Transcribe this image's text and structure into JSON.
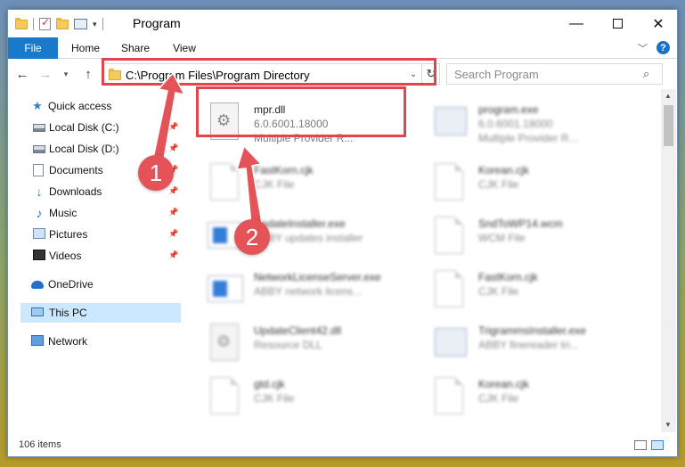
{
  "window": {
    "title": "Program",
    "controls": {
      "minimize": "—",
      "close": "✕"
    }
  },
  "ribbon": {
    "tabs": [
      "File",
      "Home",
      "Share",
      "View"
    ],
    "help": "?"
  },
  "navigation": {
    "address": "C:\\Program Files\\Program Directory",
    "search_placeholder": "Search Program"
  },
  "sidebar": {
    "quick_access": "Quick access",
    "items": [
      {
        "label": "Local Disk (C:)",
        "icon": "drive-icon",
        "pinned": true
      },
      {
        "label": "Local Disk (D:)",
        "icon": "drive-icon",
        "pinned": true
      },
      {
        "label": "Documents",
        "icon": "documents-icon",
        "pinned": true
      },
      {
        "label": "Downloads",
        "icon": "download-icon",
        "pinned": true
      },
      {
        "label": "Music",
        "icon": "music-icon",
        "pinned": true
      },
      {
        "label": "Pictures",
        "icon": "pictures-icon",
        "pinned": true
      },
      {
        "label": "Videos",
        "icon": "video-icon",
        "pinned": true
      }
    ],
    "onedrive": "OneDrive",
    "this_pc": "This PC",
    "network": "Network"
  },
  "files": [
    {
      "name": "mpr.dll",
      "line2": "6.0.6001.18000",
      "line3": "Multiple Provider R...",
      "icon": "dll"
    },
    {
      "name": "program.exe",
      "line2": "6.0.6001.18000",
      "line3": "Multiple Provider R...",
      "icon": "program"
    },
    {
      "name": "FastKorn.cjk",
      "line2": "CJK File",
      "icon": "doc"
    },
    {
      "name": "Korean.cjk",
      "line2": "CJK File",
      "icon": "doc"
    },
    {
      "name": "UpdateInstaller.exe",
      "line2": "ABBY updates installer",
      "icon": "exe"
    },
    {
      "name": "SndToWP14.wcm",
      "line2": "WCM File",
      "icon": "doc"
    },
    {
      "name": "NetworkLicenseServer.exe",
      "line2": "ABBY network licens...",
      "icon": "exe"
    },
    {
      "name": "FastKorn.cjk",
      "line2": "CJK File",
      "icon": "doc"
    },
    {
      "name": "UpdateClient42.dll",
      "line2": "Resource DLL",
      "icon": "dll"
    },
    {
      "name": "TrigrammsInstaller.exe",
      "line2": "ABBY finereader tri...",
      "icon": "installer"
    },
    {
      "name": "gtd.cjk",
      "line2": "CJK File",
      "icon": "doc"
    },
    {
      "name": "Korean.cjk",
      "line2": "CJK File",
      "icon": "doc"
    }
  ],
  "status": {
    "item_count": "106 items"
  },
  "annotations": {
    "step1": "1",
    "step2": "2",
    "color": "#e0474c"
  }
}
